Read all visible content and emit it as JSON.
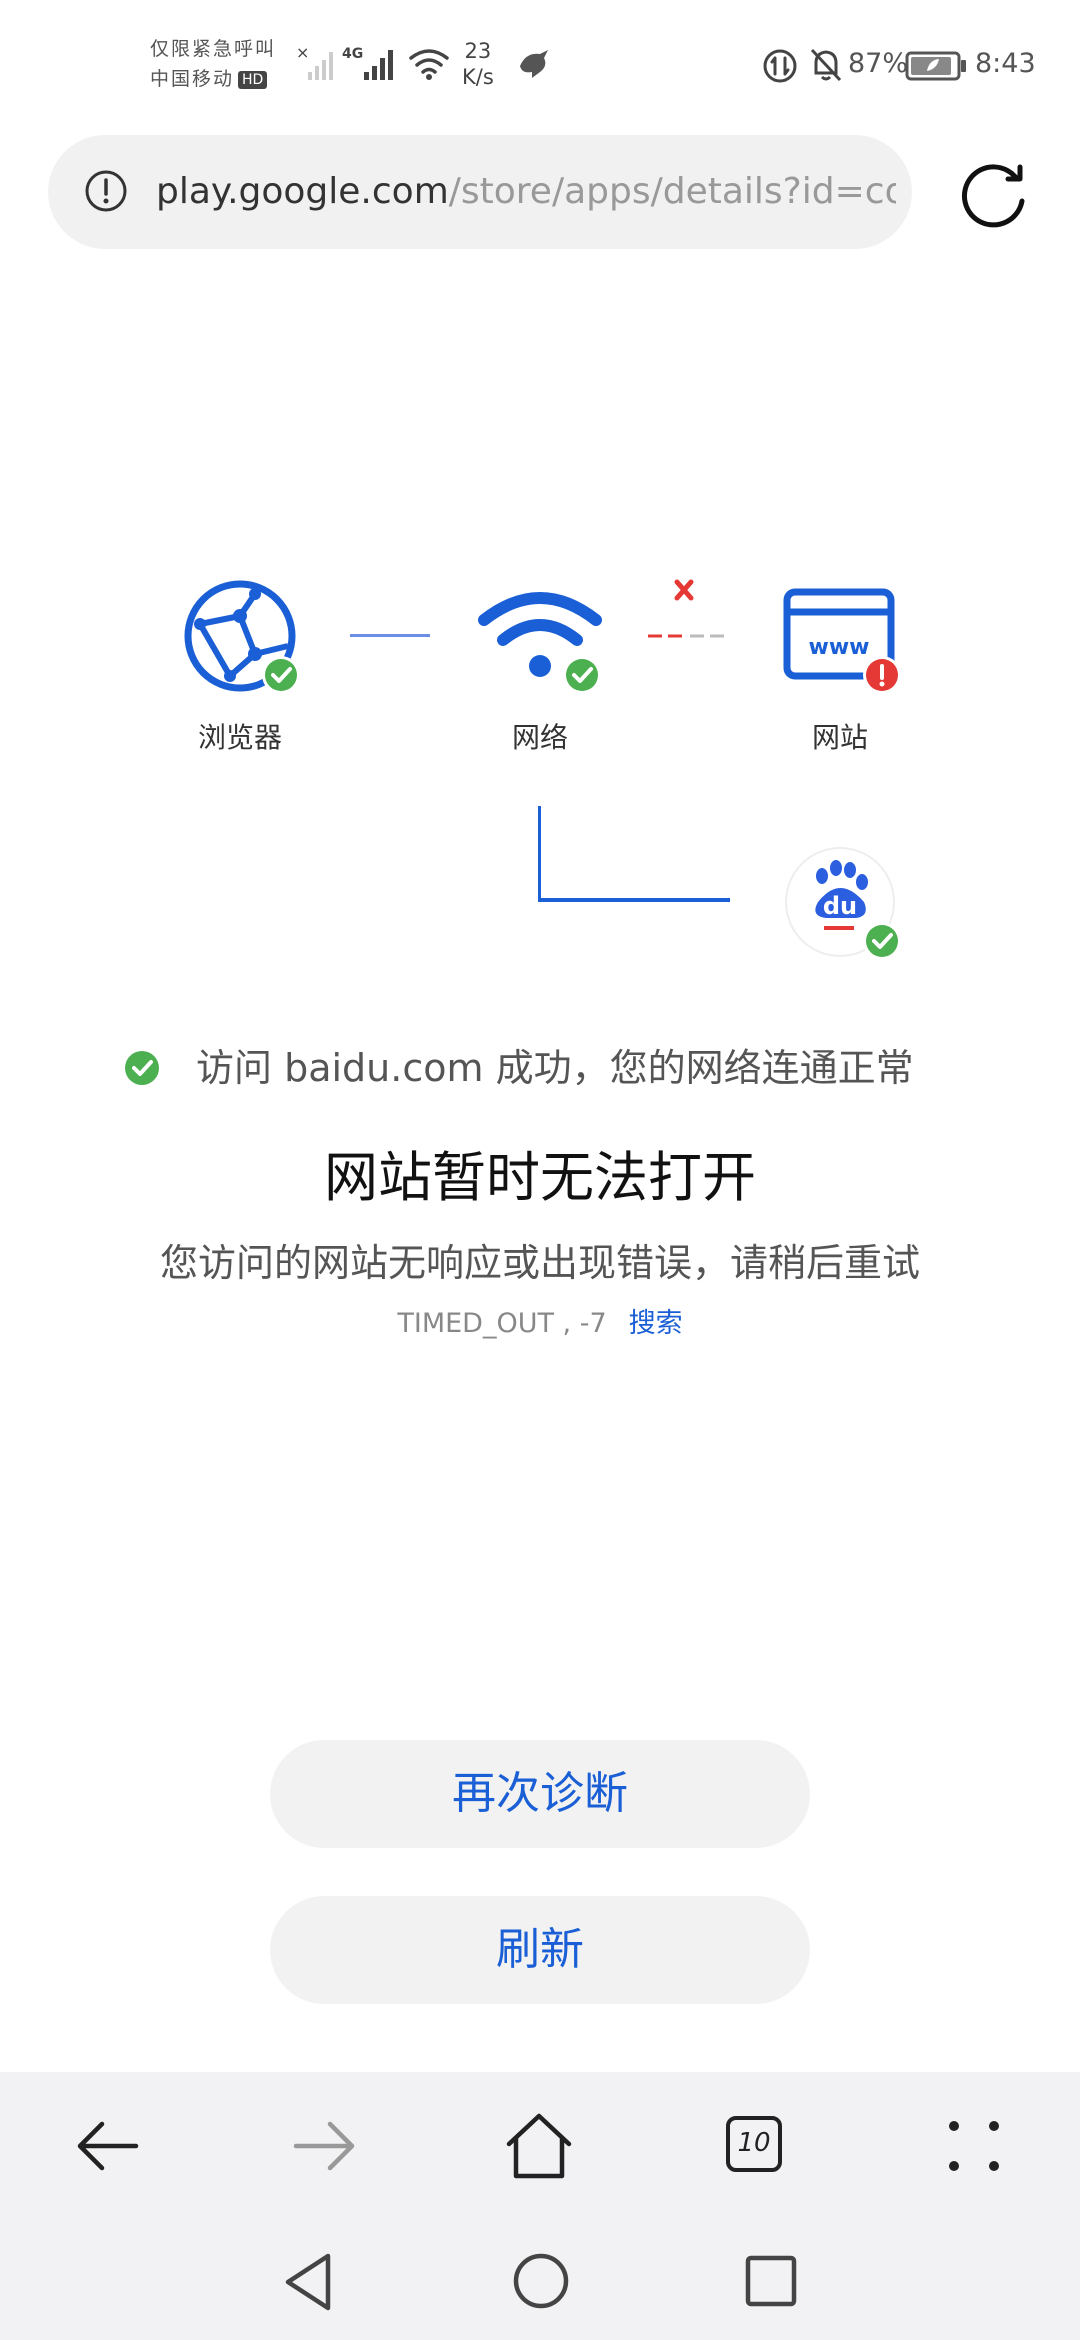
{
  "status_bar": {
    "carrier_line1": "仅限紧急呼叫",
    "carrier_line2": "中国移动",
    "hd": "HD",
    "network_type": "4G",
    "speed_value": "23",
    "speed_unit": "K/s",
    "battery_percent": "87%",
    "time": "8:43"
  },
  "url_bar": {
    "host": "play.google.com",
    "path": "/store/apps/details?id=com.t"
  },
  "diagram": {
    "browser_label": "浏览器",
    "network_label": "网络",
    "website_label": "网站",
    "www_text": "www",
    "baidu_text": "du"
  },
  "message": {
    "success": "访问 baidu.com 成功，您的网络连通正常",
    "title": "网站暂时无法打开",
    "description": "您访问的网站无响应或出现错误，请稍后重试",
    "error_code": "TIMED_OUT , -7",
    "search_link": "搜索"
  },
  "buttons": {
    "rediagnose": "再次诊断",
    "refresh": "刷新"
  },
  "toolbar": {
    "tab_count": "10"
  },
  "colors": {
    "accent_blue": "#1a5fd6",
    "success_green": "#4caf50",
    "error_red": "#e53935"
  }
}
